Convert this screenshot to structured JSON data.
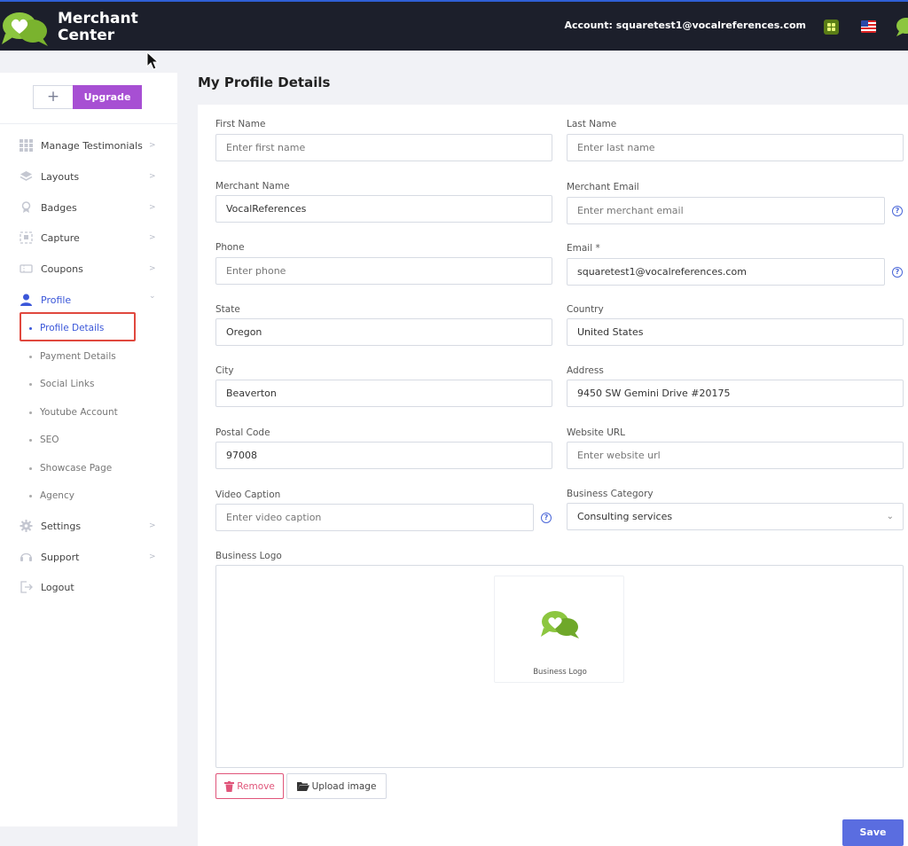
{
  "header": {
    "brand_line1": "Merchant",
    "brand_line2": "Center",
    "account": "Account: squaretest1@vocalreferences.com"
  },
  "sidebar": {
    "plus_label": "+",
    "upgrade_label": "Upgrade",
    "items": [
      {
        "label": "Manage Testimonials",
        "icon": "grid-icon"
      },
      {
        "label": "Layouts",
        "icon": "layers-icon"
      },
      {
        "label": "Badges",
        "icon": "badge-icon"
      },
      {
        "label": "Capture",
        "icon": "capture-icon"
      },
      {
        "label": "Coupons",
        "icon": "coupon-icon"
      },
      {
        "label": "Profile",
        "icon": "user-icon"
      },
      {
        "label": "Settings",
        "icon": "gear-icon"
      },
      {
        "label": "Support",
        "icon": "support-icon"
      },
      {
        "label": "Logout",
        "icon": "logout-icon"
      }
    ],
    "subitems": [
      "Profile Details",
      "Payment Details",
      "Social Links",
      "Youtube Account",
      "SEO",
      "Showcase Page",
      "Agency"
    ],
    "chevron_right": ">",
    "chevron_down": "⌄"
  },
  "page": {
    "title": "My Profile Details"
  },
  "form": {
    "first_name": {
      "label": "First Name",
      "value": "",
      "placeholder": "Enter first name"
    },
    "last_name": {
      "label": "Last Name",
      "value": "",
      "placeholder": "Enter last name"
    },
    "merchant_name": {
      "label": "Merchant Name",
      "value": "VocalReferences",
      "placeholder": ""
    },
    "merchant_email": {
      "label": "Merchant Email",
      "value": "",
      "placeholder": "Enter merchant email"
    },
    "phone": {
      "label": "Phone",
      "value": "",
      "placeholder": "Enter phone"
    },
    "email": {
      "label": "Email *",
      "value": "squaretest1@vocalreferences.com",
      "placeholder": ""
    },
    "state": {
      "label": "State",
      "value": "Oregon"
    },
    "country": {
      "label": "Country",
      "value": "United States"
    },
    "city": {
      "label": "City",
      "value": "Beaverton"
    },
    "address": {
      "label": "Address",
      "value": "9450 SW Gemini Drive #20175"
    },
    "postal_code": {
      "label": "Postal Code",
      "value": "97008"
    },
    "website_url": {
      "label": "Website URL",
      "value": "",
      "placeholder": "Enter website url"
    },
    "video_caption": {
      "label": "Video Caption",
      "value": "",
      "placeholder": "Enter video caption"
    },
    "business_category": {
      "label": "Business Category",
      "value": "Consulting services"
    },
    "business_logo": {
      "label": "Business Logo",
      "caption": "Business Logo"
    }
  },
  "buttons": {
    "remove": "Remove",
    "upload": "Upload image",
    "save": "Save"
  },
  "colors": {
    "accent": "#5a6de0",
    "upgrade": "#a74fd3",
    "topbar": "#1c1f2b",
    "brand_green": "#8cc63f",
    "remove_pink": "#e0557a",
    "highlight_red": "#e0483e"
  }
}
